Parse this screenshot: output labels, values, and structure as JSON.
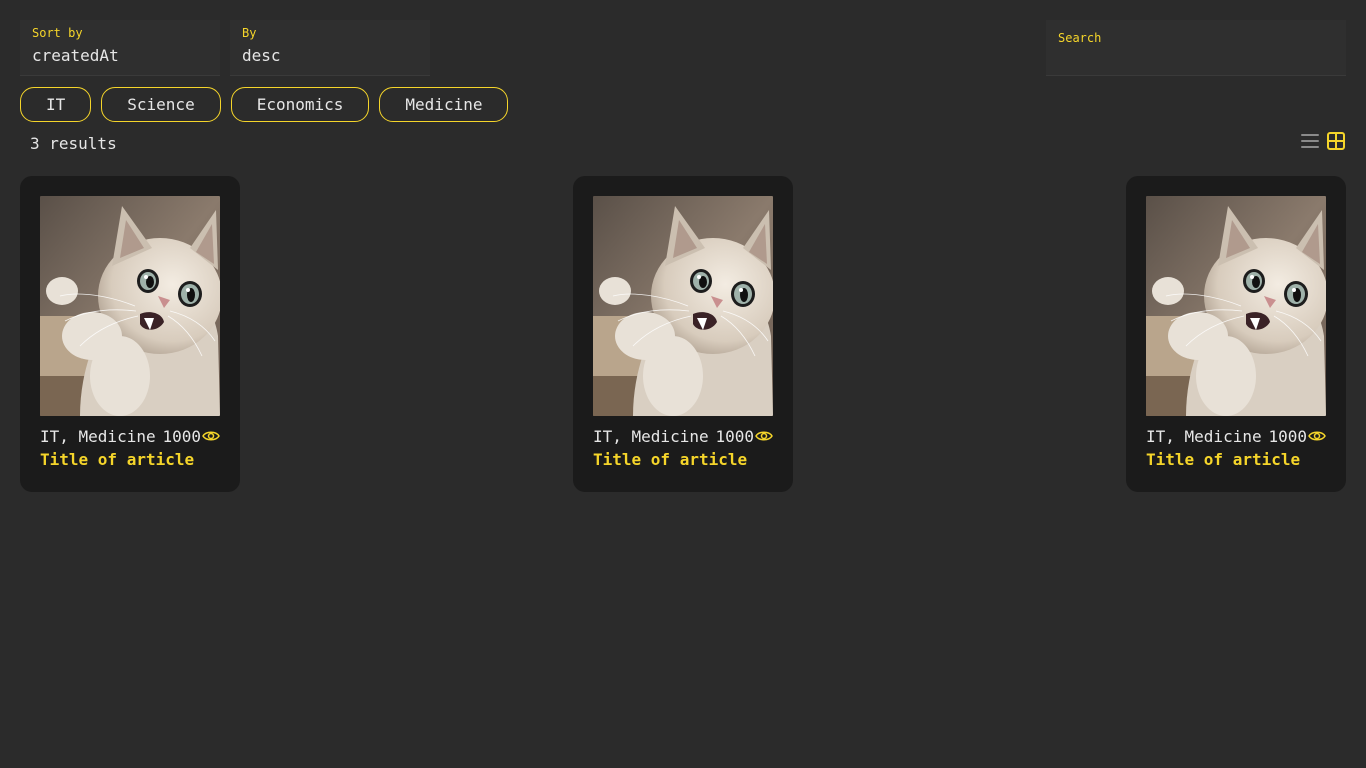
{
  "filters": {
    "sort_label": "Sort by",
    "sort_value": "createdAt",
    "order_label": "By",
    "order_value": "desc",
    "search_label": "Search",
    "search_value": ""
  },
  "tabs": [
    {
      "label": "IT"
    },
    {
      "label": "Science"
    },
    {
      "label": "Economics"
    },
    {
      "label": "Medicine"
    }
  ],
  "results": {
    "count_text": "3 results"
  },
  "view": {
    "list_icon": "list-icon",
    "grid_icon": "grid-icon",
    "active": "grid"
  },
  "articles": [
    {
      "image": "cat-photo",
      "tags": "IT, Medicine",
      "views": "1000",
      "title": "Title of article"
    },
    {
      "image": "cat-photo",
      "tags": "IT, Medicine",
      "views": "1000",
      "title": "Title of article"
    },
    {
      "image": "cat-photo",
      "tags": "IT, Medicine",
      "views": "1000",
      "title": "Title of article"
    }
  ],
  "colors": {
    "accent": "#f5d52a",
    "background": "#2b2b2b",
    "card": "#1b1b1b",
    "text": "#e6e6e6"
  }
}
